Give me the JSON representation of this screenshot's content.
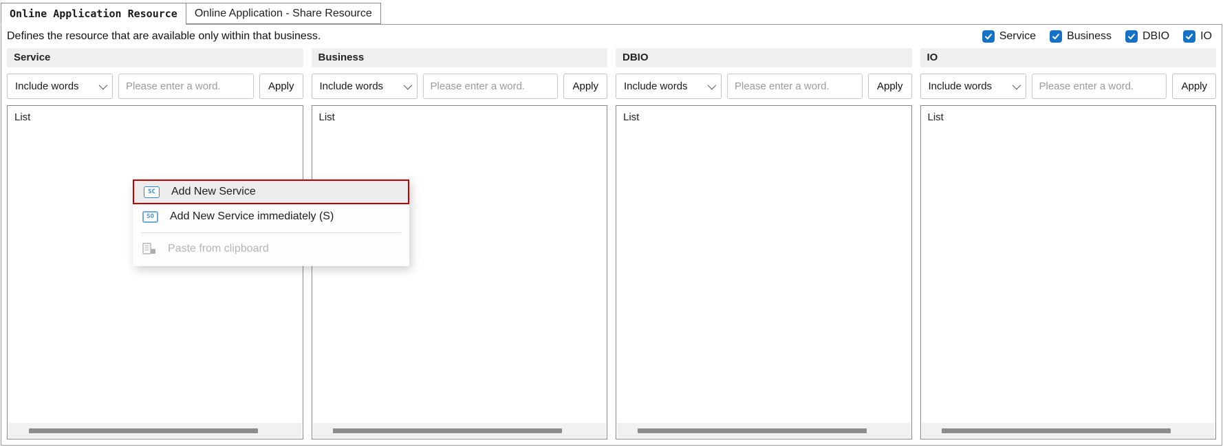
{
  "window": {
    "tabs": [
      {
        "label": "Online Application Resource",
        "active": true
      },
      {
        "label": "Online Application - Share Resource",
        "active": false
      }
    ]
  },
  "toolbar": {
    "description": "Defines the resource that are available only within that business.",
    "toggles": [
      {
        "label": "Service",
        "checked": true
      },
      {
        "label": "Business",
        "checked": true
      },
      {
        "label": "DBIO",
        "checked": true
      },
      {
        "label": "IO",
        "checked": true
      }
    ]
  },
  "filter": {
    "dropdown_label": "Include words",
    "input_placeholder": "Please enter a word.",
    "apply_label": "Apply"
  },
  "columns": [
    {
      "title": "Service",
      "list_label": "List"
    },
    {
      "title": "Business",
      "list_label": "List"
    },
    {
      "title": "DBIO",
      "list_label": "List"
    },
    {
      "title": "IO",
      "list_label": "List"
    }
  ],
  "context_menu": {
    "items": [
      {
        "label": "Add New Service",
        "icon_text": "SC",
        "selected": true,
        "disabled": false
      },
      {
        "label": "Add New Service immediately (S)",
        "icon_text": "SO",
        "selected": false,
        "disabled": false
      },
      {
        "label": "Paste from clipboard",
        "icon_text": "",
        "selected": false,
        "disabled": true
      }
    ]
  },
  "colors": {
    "checkbox_blue": "#1572c6",
    "menu_highlight_border": "#c00000",
    "icon_blue": "#2f86d2",
    "icon_blue_light": "#6fa8dc",
    "header_bg": "#efefef",
    "scroll_thumb": "#8c8c8c"
  }
}
